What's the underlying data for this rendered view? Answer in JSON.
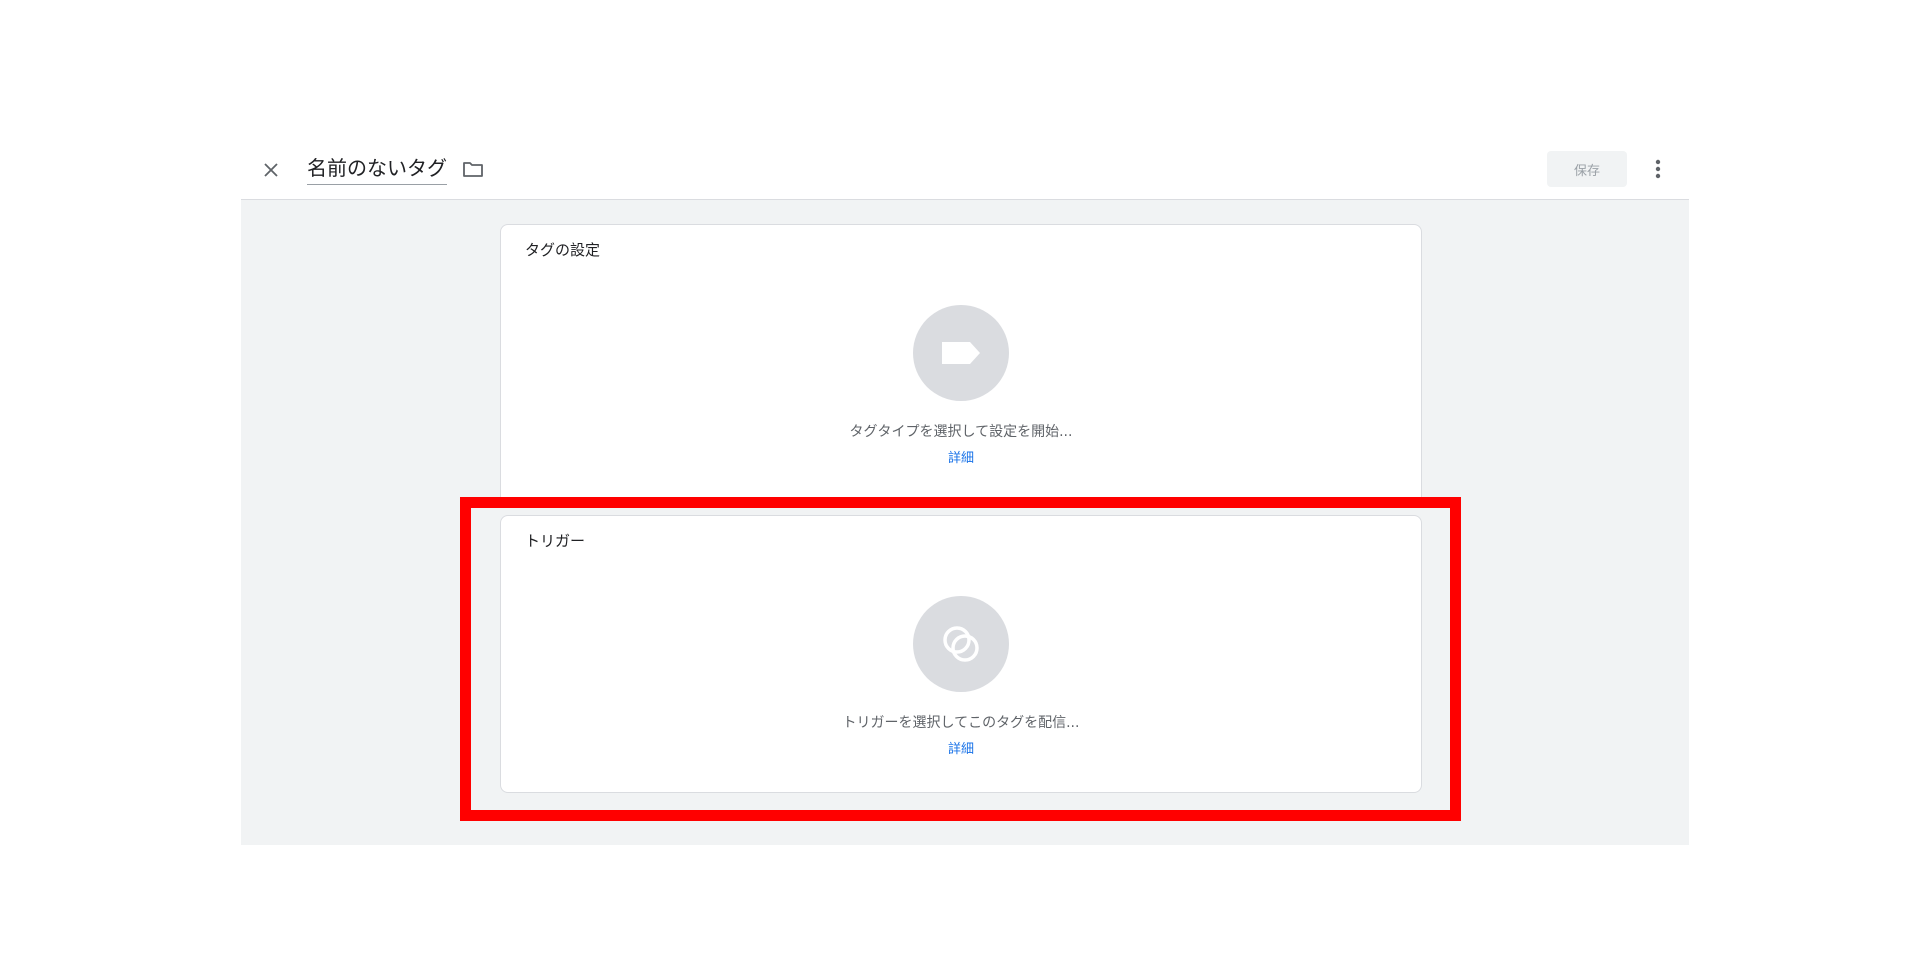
{
  "header": {
    "tag_name": "名前のないタグ",
    "save_label": "保存"
  },
  "tag_config": {
    "title": "タグの設定",
    "hint": "タグタイプを選択して設定を開始...",
    "learn_more": "詳細"
  },
  "triggering": {
    "title": "トリガー",
    "hint": "トリガーを選択してこのタグを配信...",
    "learn_more": "詳細"
  },
  "colors": {
    "highlight": "#ff0000",
    "link": "#1a73e8",
    "icon_circle": "#dadce0",
    "panel_bg": "#f1f3f4"
  },
  "icons": {
    "close": "close-icon",
    "folder": "folder-icon",
    "more": "more-vert-icon",
    "tag_type": "tag-label-icon",
    "trigger": "trigger-circles-icon"
  }
}
